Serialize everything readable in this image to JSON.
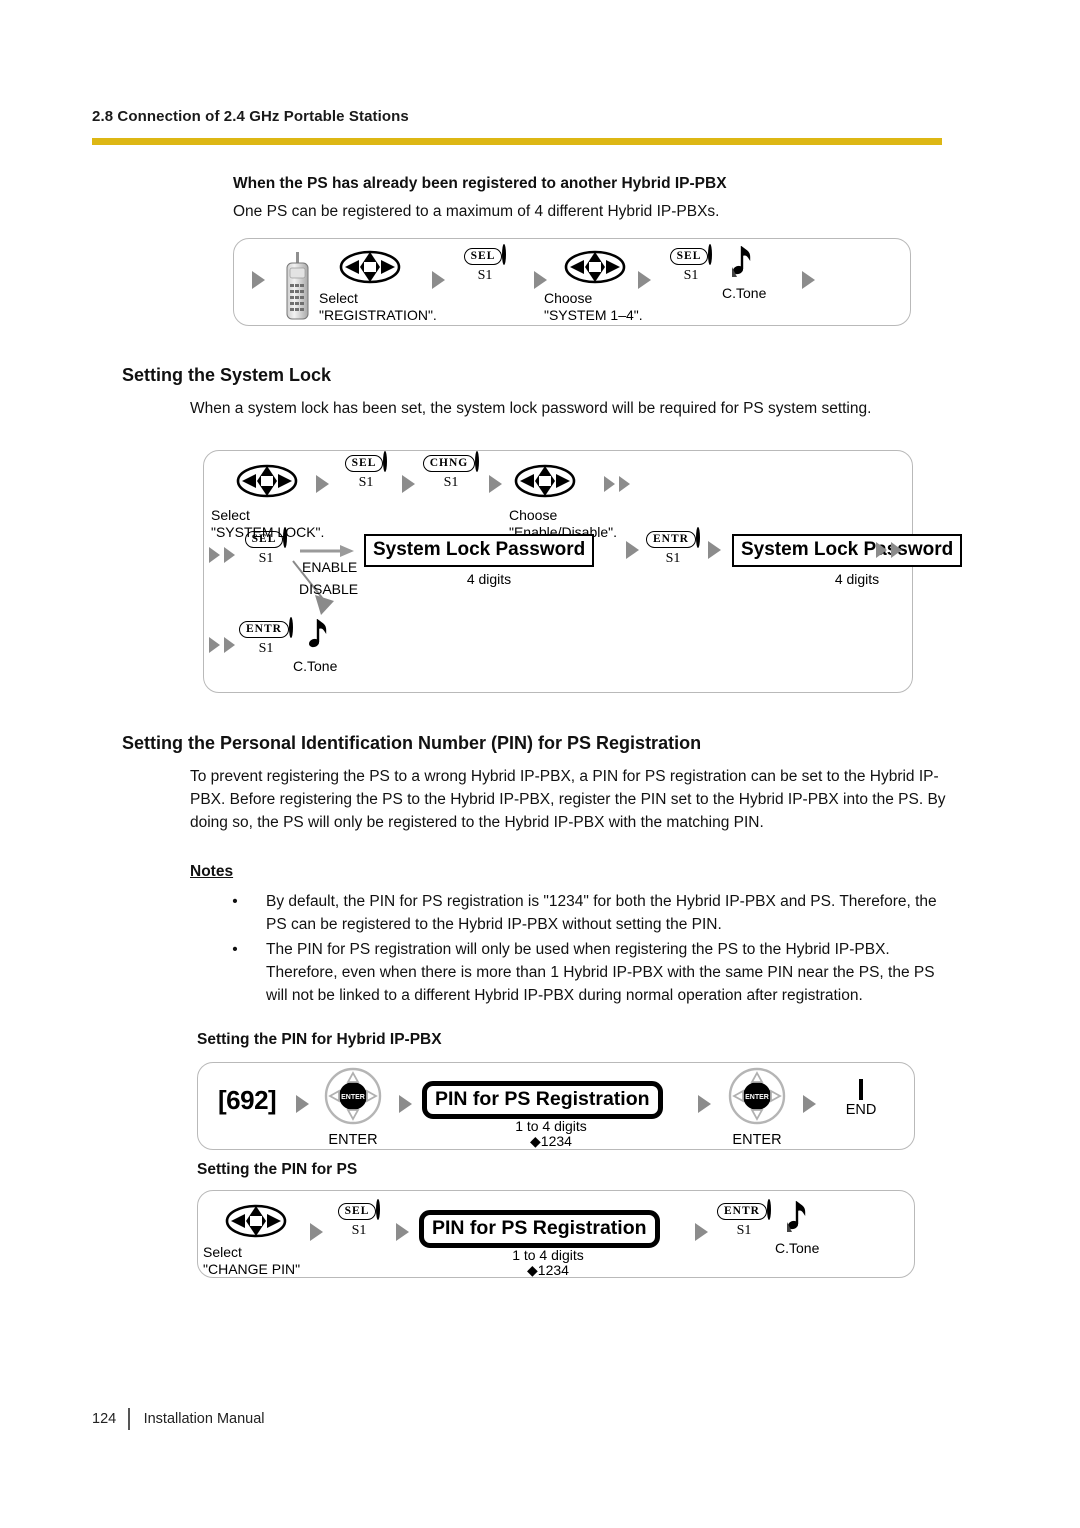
{
  "header": {
    "section_title": "2.8 Connection of 2.4 GHz Portable Stations",
    "rule_color": "#ddb714"
  },
  "registered_section": {
    "heading": "When the PS has already been registered to another Hybrid IP-PBX",
    "body": "One PS can be registered to a maximum of 4 different Hybrid IP-PBXs.",
    "flow": {
      "handset_icon": "cordless-handset-icon",
      "step1_line1": "Select",
      "step1_line2": "\"REGISTRATION\".",
      "key1_cap": "SEL",
      "key1_sub": "S1",
      "step2_line1": "Choose",
      "step2_line2": "\"SYSTEM 1–4\".",
      "key2_cap": "SEL",
      "key2_sub": "S1",
      "ctone": "C.Tone"
    }
  },
  "system_lock_section": {
    "heading": "Setting the System Lock",
    "body": "When a system lock has been set, the system lock password will be required for PS system setting.",
    "flow": {
      "nav1_line1": "Select",
      "nav1_line2": "\"SYSTEM LOCK\".",
      "key1_cap": "SEL",
      "key1_sub": "S1",
      "key2_cap": "CHNG",
      "key2_sub": "S1",
      "nav2_line1": "Choose",
      "nav2_line2": "\"Enable/Disable\".",
      "key3_cap": "SEL",
      "key3_sub": "S1",
      "branch_enable": "ENABLE",
      "branch_disable": "DISABLE",
      "display1": "System Lock Password",
      "display1_sub": "4 digits",
      "key4_cap": "ENTR",
      "key4_sub": "S1",
      "display2": "System Lock Password",
      "display2_sub": "4 digits",
      "key5_cap": "ENTR",
      "key5_sub": "S1",
      "ctone": "C.Tone"
    }
  },
  "pin_section": {
    "heading": "Setting the Personal Identification Number (PIN) for PS Registration",
    "body": "To prevent registering the PS to a wrong Hybrid IP-PBX, a PIN for PS registration can be set to the Hybrid IP-PBX. Before registering the PS to the Hybrid IP-PBX, register the PIN set to the Hybrid IP-PBX into the PS. By doing so, the PS will only be registered to the Hybrid IP-PBX with the matching PIN.",
    "notes_label": "Notes",
    "notes": [
      "By default, the PIN for PS registration is \"1234\" for both the Hybrid IP-PBX and PS. Therefore, the PS can be registered to the Hybrid IP-PBX without setting the PIN.",
      "The PIN for PS registration will only be used when registering the PS to the Hybrid IP-PBX. Therefore, even when there is more than 1 Hybrid IP-PBX with the same PIN near the PS, the PS will not be linked to a different Hybrid IP-PBX during normal operation after registration."
    ],
    "pbx_flow": {
      "heading": "Setting the PIN for Hybrid IP-PBX",
      "code": "[692]",
      "key1_label": "ENTER",
      "display": "PIN for PS Registration",
      "display_sub1": "1 to 4 digits",
      "display_sub2": "◆1234",
      "key2_label": "ENTER",
      "end_label": "END"
    },
    "ps_flow": {
      "heading": "Setting the PIN for PS",
      "nav_line1": "Select",
      "nav_line2": "\"CHANGE PIN\"",
      "key1_cap": "SEL",
      "key1_sub": "S1",
      "display": "PIN for PS Registration",
      "display_sub1": "1 to 4 digits",
      "display_sub2": "◆1234",
      "key2_cap": "ENTR",
      "key2_sub": "S1",
      "ctone": "C.Tone"
    }
  },
  "footer": {
    "page_number": "124",
    "manual_name": "Installation Manual"
  }
}
